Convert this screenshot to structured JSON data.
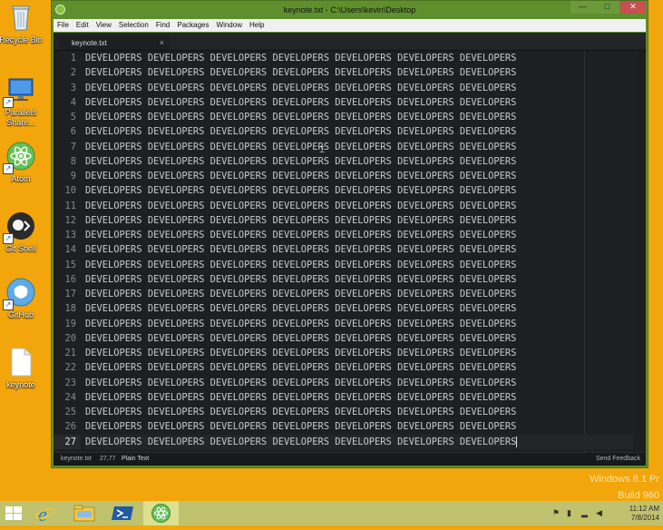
{
  "desktop": {
    "icons": [
      {
        "label": "Recycle Bin"
      },
      {
        "label": "Parallels Share..."
      },
      {
        "label": "Atom"
      },
      {
        "label": "Git Shell"
      },
      {
        "label": "GitHub"
      },
      {
        "label": "keynote"
      }
    ],
    "watermark": {
      "line1": "Windows 8.1 Pr",
      "line2": "Build 960"
    }
  },
  "window": {
    "title": "keynote.txt - C:\\Users\\kevin\\Desktop",
    "controls": {
      "min": "—",
      "max": "□",
      "close": "✕"
    }
  },
  "menu": [
    "File",
    "Edit",
    "View",
    "Selection",
    "Find",
    "Packages",
    "Window",
    "Help"
  ],
  "tab": {
    "title": "keynote.txt",
    "close": "×"
  },
  "editor": {
    "line_text": "DEVELOPERS DEVELOPERS DEVELOPERS DEVELOPERS DEVELOPERS DEVELOPERS DEVELOPERS",
    "line_numbers": [
      "1",
      "2",
      "3",
      "4",
      "5",
      "6",
      "7",
      "8",
      "9",
      "10",
      "11",
      "12",
      "13",
      "14",
      "15",
      "16",
      "17",
      "18",
      "19",
      "20",
      "21",
      "22",
      "23",
      "24",
      "25",
      "26",
      "27"
    ]
  },
  "status": {
    "file": "keynote.txt",
    "position": "27,77",
    "grammar": "Plain Text",
    "feedback": "Send Feedback"
  },
  "taskbar": {
    "time": "11:12 AM",
    "date": "7/8/2014"
  },
  "colors": {
    "desktop": "#f2a60c",
    "window_frame": "#5f8f2d",
    "editor_bg": "#1d1f21",
    "taskbar": "#c0c26d"
  }
}
